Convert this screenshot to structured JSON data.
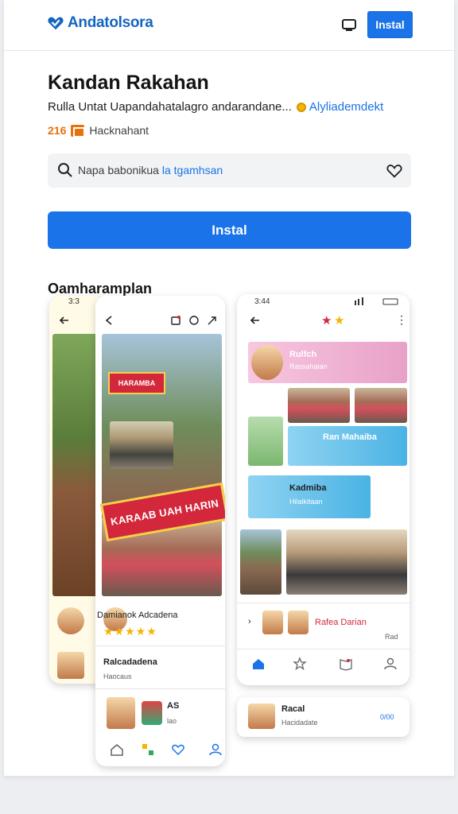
{
  "header": {
    "brand": "Andatolsora",
    "install_label": "Instal",
    "icons": {
      "logo": "heart-check-icon",
      "screen": "screen-share-icon"
    }
  },
  "app": {
    "title": "Kandan Rakahan",
    "subtitle": "Rulla Untat Uapandahatalagro andarandane...",
    "developer": "Alyliademdekt",
    "stats_count": "216",
    "stats_label": "Hacknahant"
  },
  "search": {
    "text": "Napa babonikua",
    "highlight": "la tgamhsan",
    "icons": {
      "search": "search-icon",
      "favorite": "heart-icon"
    }
  },
  "install_button_label": "Instal",
  "screenshots_title": "Oamharamplan",
  "phone_left": {
    "time": "3:3"
  },
  "phone_mid": {
    "banner_text": "KARAAB UAH HARIN",
    "small_banner": "HARAMBA",
    "item1_title": "Damianok Adcadena",
    "item1_stars": "★★★★★",
    "item2_title": "Ralcadadena",
    "item2_sub": "Haocaus",
    "item3_title": "AS",
    "item3_sub": "lao"
  },
  "phone_right": {
    "time": "3:44",
    "card1_title": "Rulfch",
    "card1_sub": "Rassahaian",
    "card2_title": "Ran Mahaiba",
    "card3_title": "Kadmiba",
    "card3_sub": "Hilaikitaan",
    "row_title": "Rafea Darian",
    "row_side": "Rad"
  },
  "phone_bottom": {
    "title": "Racal",
    "sub": "Hacidadate",
    "side": "0/00"
  },
  "colors": {
    "accent": "#1a73e8",
    "brand": "#1565c0",
    "stats": "#e8710a",
    "banner": "#d3283b"
  }
}
